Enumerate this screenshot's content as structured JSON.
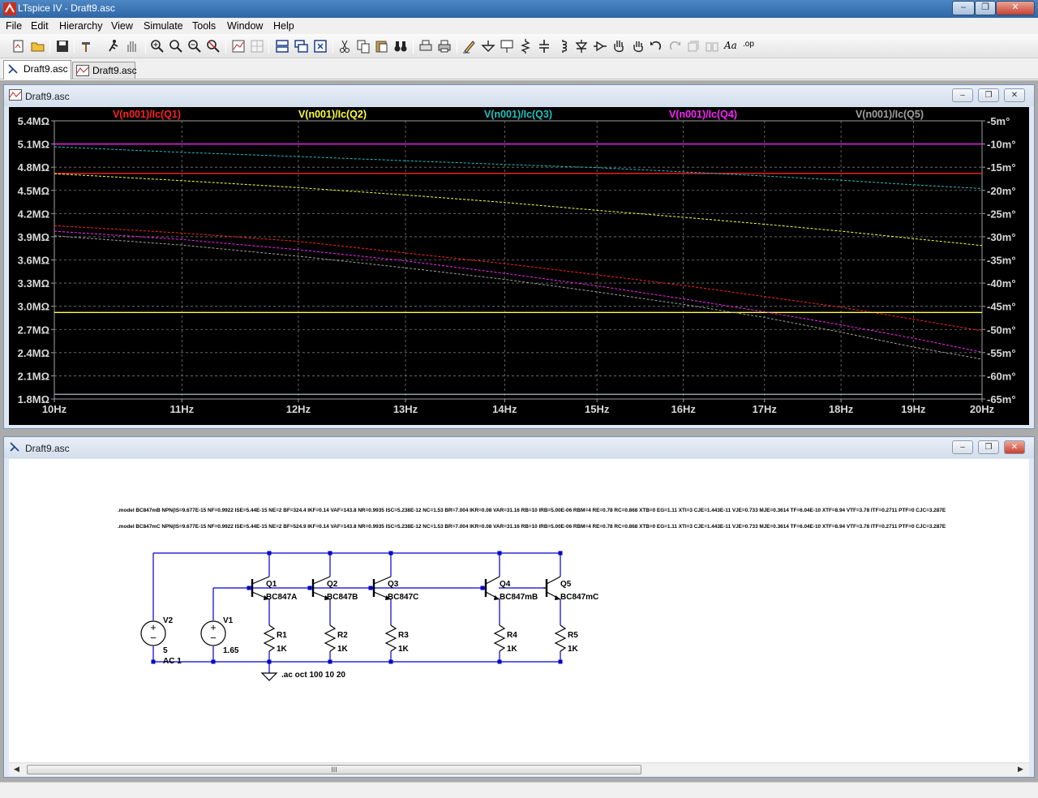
{
  "window": {
    "title": "LTspice IV - Draft9.asc"
  },
  "menu": [
    {
      "label": "File"
    },
    {
      "label": "Edit"
    },
    {
      "label": "Hierarchy"
    },
    {
      "label": "View"
    },
    {
      "label": "Simulate"
    },
    {
      "label": "Tools"
    },
    {
      "label": "Window"
    },
    {
      "label": "Help"
    }
  ],
  "toolbar": {
    "italic_tool_label": "Aa",
    "op_tool_label": ".op"
  },
  "tabs": [
    {
      "label": "Draft9.asc",
      "kind": "schematic",
      "active": true
    },
    {
      "label": "Draft9.asc",
      "kind": "waveform",
      "active": false
    }
  ],
  "plot_window": {
    "title": "Draft9.asc",
    "chart_data": {
      "type": "line",
      "x_scale": "log",
      "xlim": [
        10,
        20
      ],
      "x_ticks": [
        "10Hz",
        "11Hz",
        "12Hz",
        "13Hz",
        "14Hz",
        "15Hz",
        "16Hz",
        "17Hz",
        "18Hz",
        "19Hz",
        "20Hz"
      ],
      "y_left_ticks": [
        "5.4MΩ",
        "5.1MΩ",
        "4.8MΩ",
        "4.5MΩ",
        "4.2MΩ",
        "3.9MΩ",
        "3.6MΩ",
        "3.3MΩ",
        "3.0MΩ",
        "2.7MΩ",
        "2.4MΩ",
        "2.1MΩ",
        "1.8MΩ"
      ],
      "y_left_range_ohm_mega": [
        1.8,
        5.4
      ],
      "y_right_ticks": [
        "-5m°",
        "-10m°",
        "-15m°",
        "-20m°",
        "-25m°",
        "-30m°",
        "-35m°",
        "-40m°",
        "-45m°",
        "-50m°",
        "-55m°",
        "-60m°",
        "-65m°"
      ],
      "y_right_range_mdeg": [
        -65,
        -5
      ],
      "grid": true,
      "legend_position": "top",
      "series": [
        {
          "name": "V(n001)/Ic(Q1)",
          "color": "#ff2020",
          "magnitude": {
            "x": [
              10,
              20
            ],
            "y": [
              4.72,
              4.72
            ]
          },
          "phase": {
            "x": [
              10,
              11,
              12,
              13,
              14,
              15,
              16,
              17,
              18,
              19,
              20
            ],
            "y": [
              -27.6,
              -29.2,
              -31.0,
              -33.5,
              -35.8,
              -38.2,
              -40.5,
              -42.9,
              -45.2,
              -47.8,
              -50.3
            ]
          }
        },
        {
          "name": "V(n001)/Ic(Q2)",
          "color": "#ffff40",
          "magnitude": {
            "x": [
              10,
              20
            ],
            "y": [
              2.92,
              2.92
            ]
          },
          "phase": {
            "x": [
              10,
              11,
              12,
              13,
              14,
              15,
              16,
              17,
              18,
              19,
              20
            ],
            "y": [
              -16.4,
              -17.9,
              -19.4,
              -21.0,
              -22.6,
              -24.3,
              -25.8,
              -27.3,
              -28.8,
              -30.4,
              -31.9
            ]
          }
        },
        {
          "name": "V(n001)/Ic(Q3)",
          "color": "#20c0c0",
          "magnitude": {
            "x": [
              10,
              20
            ],
            "y": [
              1.86,
              1.86
            ]
          },
          "phase": {
            "x": [
              10,
              11,
              12,
              13,
              14,
              15,
              16,
              17,
              18,
              19,
              20
            ],
            "y": [
              -10.6,
              -11.8,
              -12.7,
              -13.6,
              -14.4,
              -15.1,
              -16.0,
              -16.9,
              -17.8,
              -18.8,
              -19.6
            ]
          }
        },
        {
          "name": "V(n001)/Ic(Q4)",
          "color": "#ff20ff",
          "magnitude": {
            "x": [
              10,
              20
            ],
            "y": [
              5.1,
              5.1
            ]
          },
          "phase": {
            "x": [
              10,
              11,
              12,
              13,
              14,
              15,
              16,
              17,
              18,
              19,
              20
            ],
            "y": [
              -28.8,
              -30.6,
              -32.8,
              -35.2,
              -37.9,
              -40.6,
              -43.4,
              -46.2,
              -49.0,
              -51.9,
              -54.9
            ]
          }
        },
        {
          "name": "V(n001)/Ic(Q5)",
          "color": "#a0a0a0",
          "magnitude": {
            "x": [
              10,
              20
            ],
            "y": [
              1.86,
              1.86
            ]
          },
          "phase": {
            "x": [
              10,
              11,
              12,
              13,
              14,
              15,
              16,
              17,
              18,
              19,
              20
            ],
            "y": [
              -29.8,
              -31.8,
              -34.2,
              -36.7,
              -39.2,
              -41.9,
              -44.6,
              -47.4,
              -50.6,
              -53.8,
              -56.4
            ]
          }
        }
      ]
    }
  },
  "schematic_window": {
    "title": "Draft9.asc",
    "model_lines": [
      ".model BC847mB NPN(IS=9.677E-15 NF=0.9922 ISE=5.44E-15 NE=2 BF=324.4 IKF=0.14 VAF=143.8 NR=0.9935 ISC=5.238E-12 NC=1.53 BR=7.004 IKR=0.08 VAR=31.16 RB=10 IRB=5.00E-06 RBM=4 RE=0.78 RC=0.868 XTB=0 EG=1.11 XTI=3 CJE=1.443E-11 VJE=0.733 MJE=0.3614 TF=6.04E-10 XTF=8.94 VTF=3.78 ITF=0.2711 PTF=0 CJC=3.287E",
      ".model BC847mC NPN(IS=9.677E-15 NF=0.9922 ISE=5.44E-15 NE=2 BF=524.9 IKF=0.14 VAF=143.8 NR=0.9935 ISC=5.238E-12 NC=1.53 BR=7.004 IKR=0.08 VAR=31.16 RB=10 IRB=5.00E-06 RBM=4 RE=0.78 RC=0.868 XTB=0 EG=1.11 XTI=3 CJE=1.443E-11 VJE=0.733 MJE=0.3614 TF=6.04E-10 XTF=8.94 VTF=3.78 ITF=0.2711 PTF=0 CJC=3.287E"
    ],
    "sources": [
      {
        "ref": "V2",
        "value": "5",
        "extra": "AC 1"
      },
      {
        "ref": "V1",
        "value": "1.65",
        "extra": ""
      }
    ],
    "transistors": [
      {
        "ref": "Q1",
        "model": "BC847A"
      },
      {
        "ref": "Q2",
        "model": "BC847B"
      },
      {
        "ref": "Q3",
        "model": "BC847C"
      },
      {
        "ref": "Q4",
        "model": "BC847mB"
      },
      {
        "ref": "Q5",
        "model": "BC847mC"
      }
    ],
    "resistors": [
      {
        "ref": "R1",
        "value": "1K"
      },
      {
        "ref": "R2",
        "value": "1K"
      },
      {
        "ref": "R3",
        "value": "1K"
      },
      {
        "ref": "R4",
        "value": "1K"
      },
      {
        "ref": "R5",
        "value": "1K"
      }
    ],
    "directive": ".ac oct 100 10 20",
    "colors": {
      "wire": "#0000c8",
      "junction": "#0000c8",
      "text": "#000000"
    },
    "scroll_grip": "III"
  }
}
